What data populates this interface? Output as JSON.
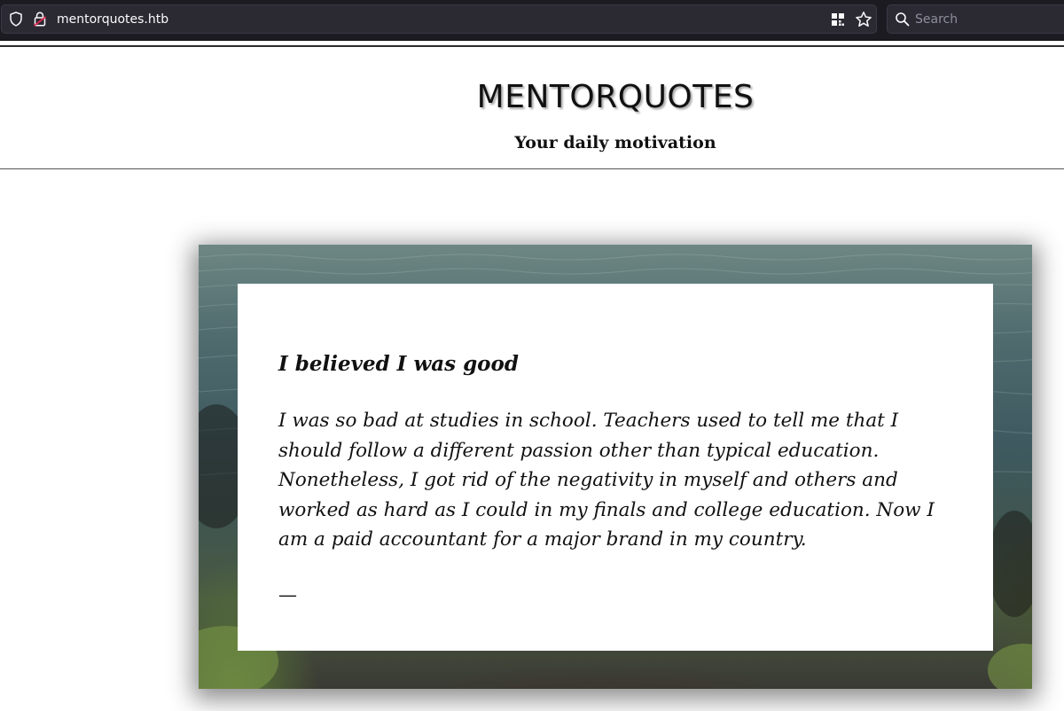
{
  "browser": {
    "url": "mentorquotes.htb",
    "search_placeholder": "Search",
    "icons": {
      "shield": "tracking-protection-shield-icon",
      "lock": "insecure-lock-icon",
      "grid": "qr-code-icon",
      "star": "bookmark-star-icon",
      "search": "magnifier-icon"
    }
  },
  "site": {
    "title": "MENTORQUOTES",
    "subtitle": "Your daily motivation"
  },
  "quote": {
    "title": "I believed I was good",
    "body": "I was so bad at studies in school. Teachers used to tell me that I should follow a different passion other than typical education. Nonetheless, I got rid of the negativity in myself and others and worked as hard as I could in my finals and college education. Now I am a paid accountant for a major brand in my country.",
    "attribution": "—"
  },
  "colors": {
    "chrome_bg": "#1c1b22",
    "field_bg": "#2b2a33",
    "lock_accent": "#e22850",
    "page_text": "#111111"
  }
}
